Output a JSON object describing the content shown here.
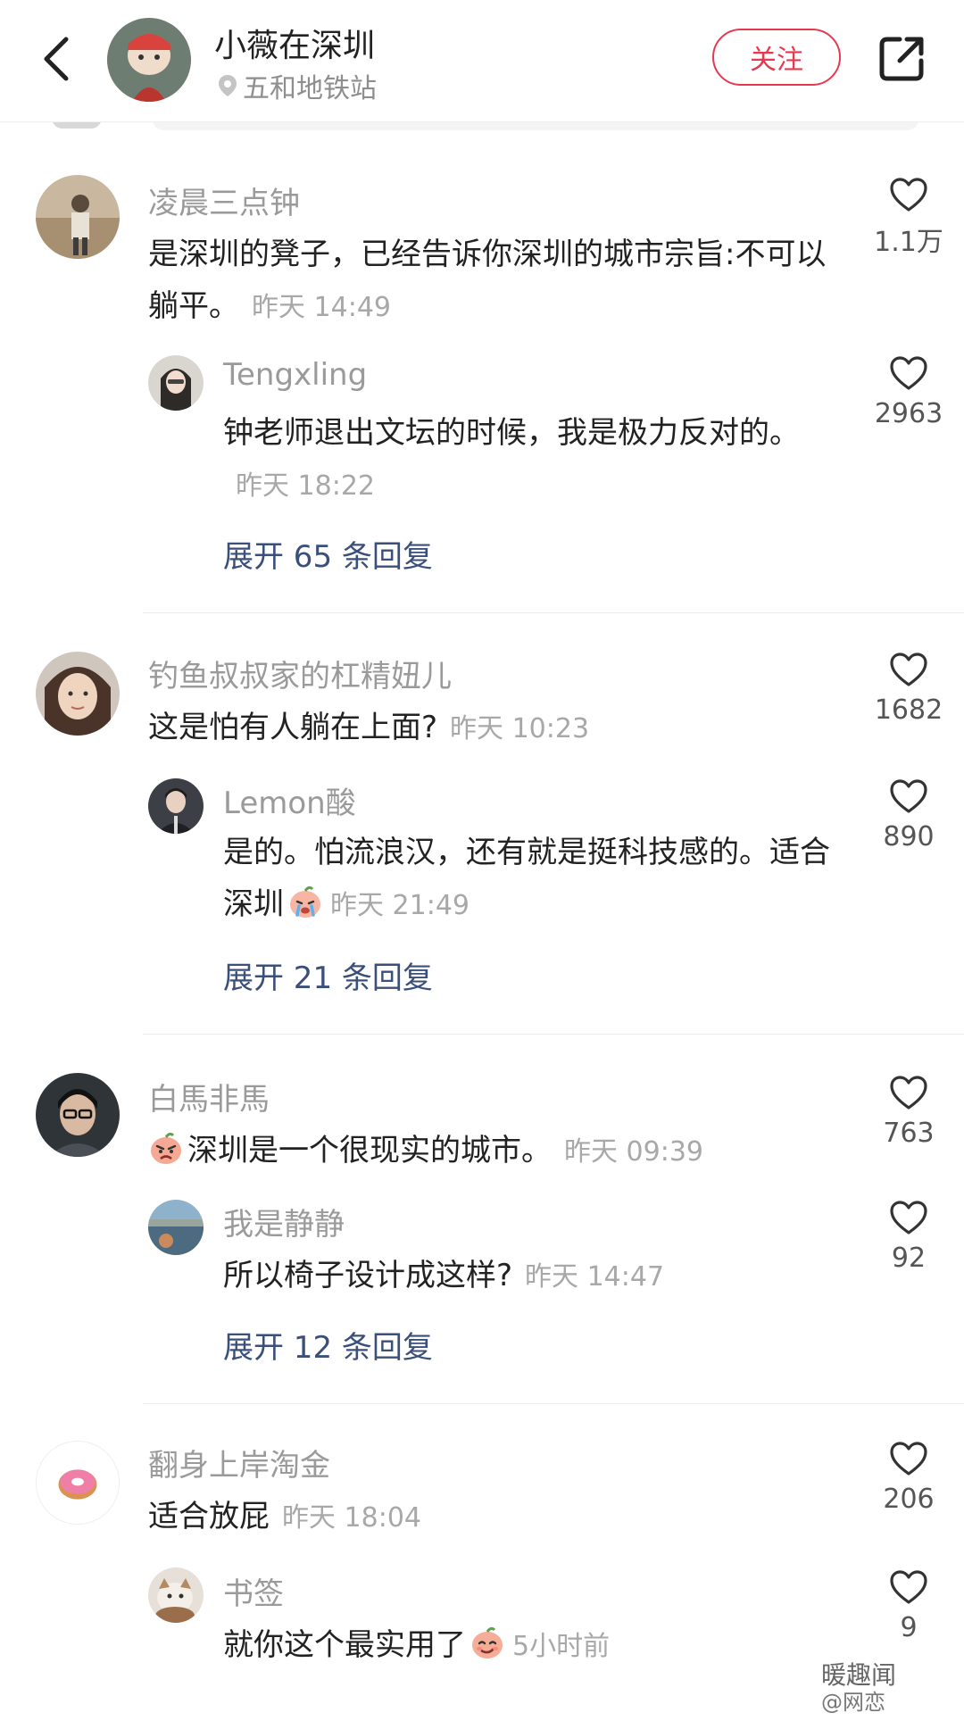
{
  "header": {
    "author_name": "小薇在深圳",
    "location": "五和地铁站",
    "follow_label": "关注"
  },
  "comments": [
    {
      "user": "凌晨三点钟",
      "text": "是深圳的凳子，已经告诉你深圳的城市宗旨:不可以躺平。",
      "time": "昨天 14:49",
      "likes": "1.1万",
      "reply": {
        "user": "Tengxling",
        "text": "钟老师退出文坛的时候，我是极力反对的。",
        "time": "昨天 18:22",
        "likes": "2963"
      },
      "expand": "展开 65 条回复"
    },
    {
      "user": "钓鱼叔叔家的杠精妞儿",
      "text": "这是怕有人躺在上面?",
      "time": "昨天 10:23",
      "likes": "1682",
      "reply": {
        "user": "Lemon酸",
        "text": "是的。怕流浪汉，还有就是挺科技感的。适合深圳",
        "time": "昨天 21:49",
        "likes": "890"
      },
      "expand": "展开 21 条回复"
    },
    {
      "user": "白馬非馬",
      "text": "深圳是一个很现实的城市。",
      "time": "昨天 09:39",
      "likes": "763",
      "reply": {
        "user": "我是静静",
        "text": "所以椅子设计成这样?",
        "time": "昨天 14:47",
        "likes": "92"
      },
      "expand": "展开 12 条回复"
    },
    {
      "user": "翻身上岸淘金",
      "text": "适合放屁",
      "time": "昨天 18:04",
      "likes": "206",
      "reply": {
        "user": "书签",
        "text": "就你这个最实用了",
        "time": "5小时前",
        "likes": "9"
      }
    }
  ],
  "watermark": {
    "line1": "暖趣闻",
    "line2": "@网恋"
  },
  "colors": {
    "accent": "#e6394f",
    "expand": "#3a4f7a"
  }
}
